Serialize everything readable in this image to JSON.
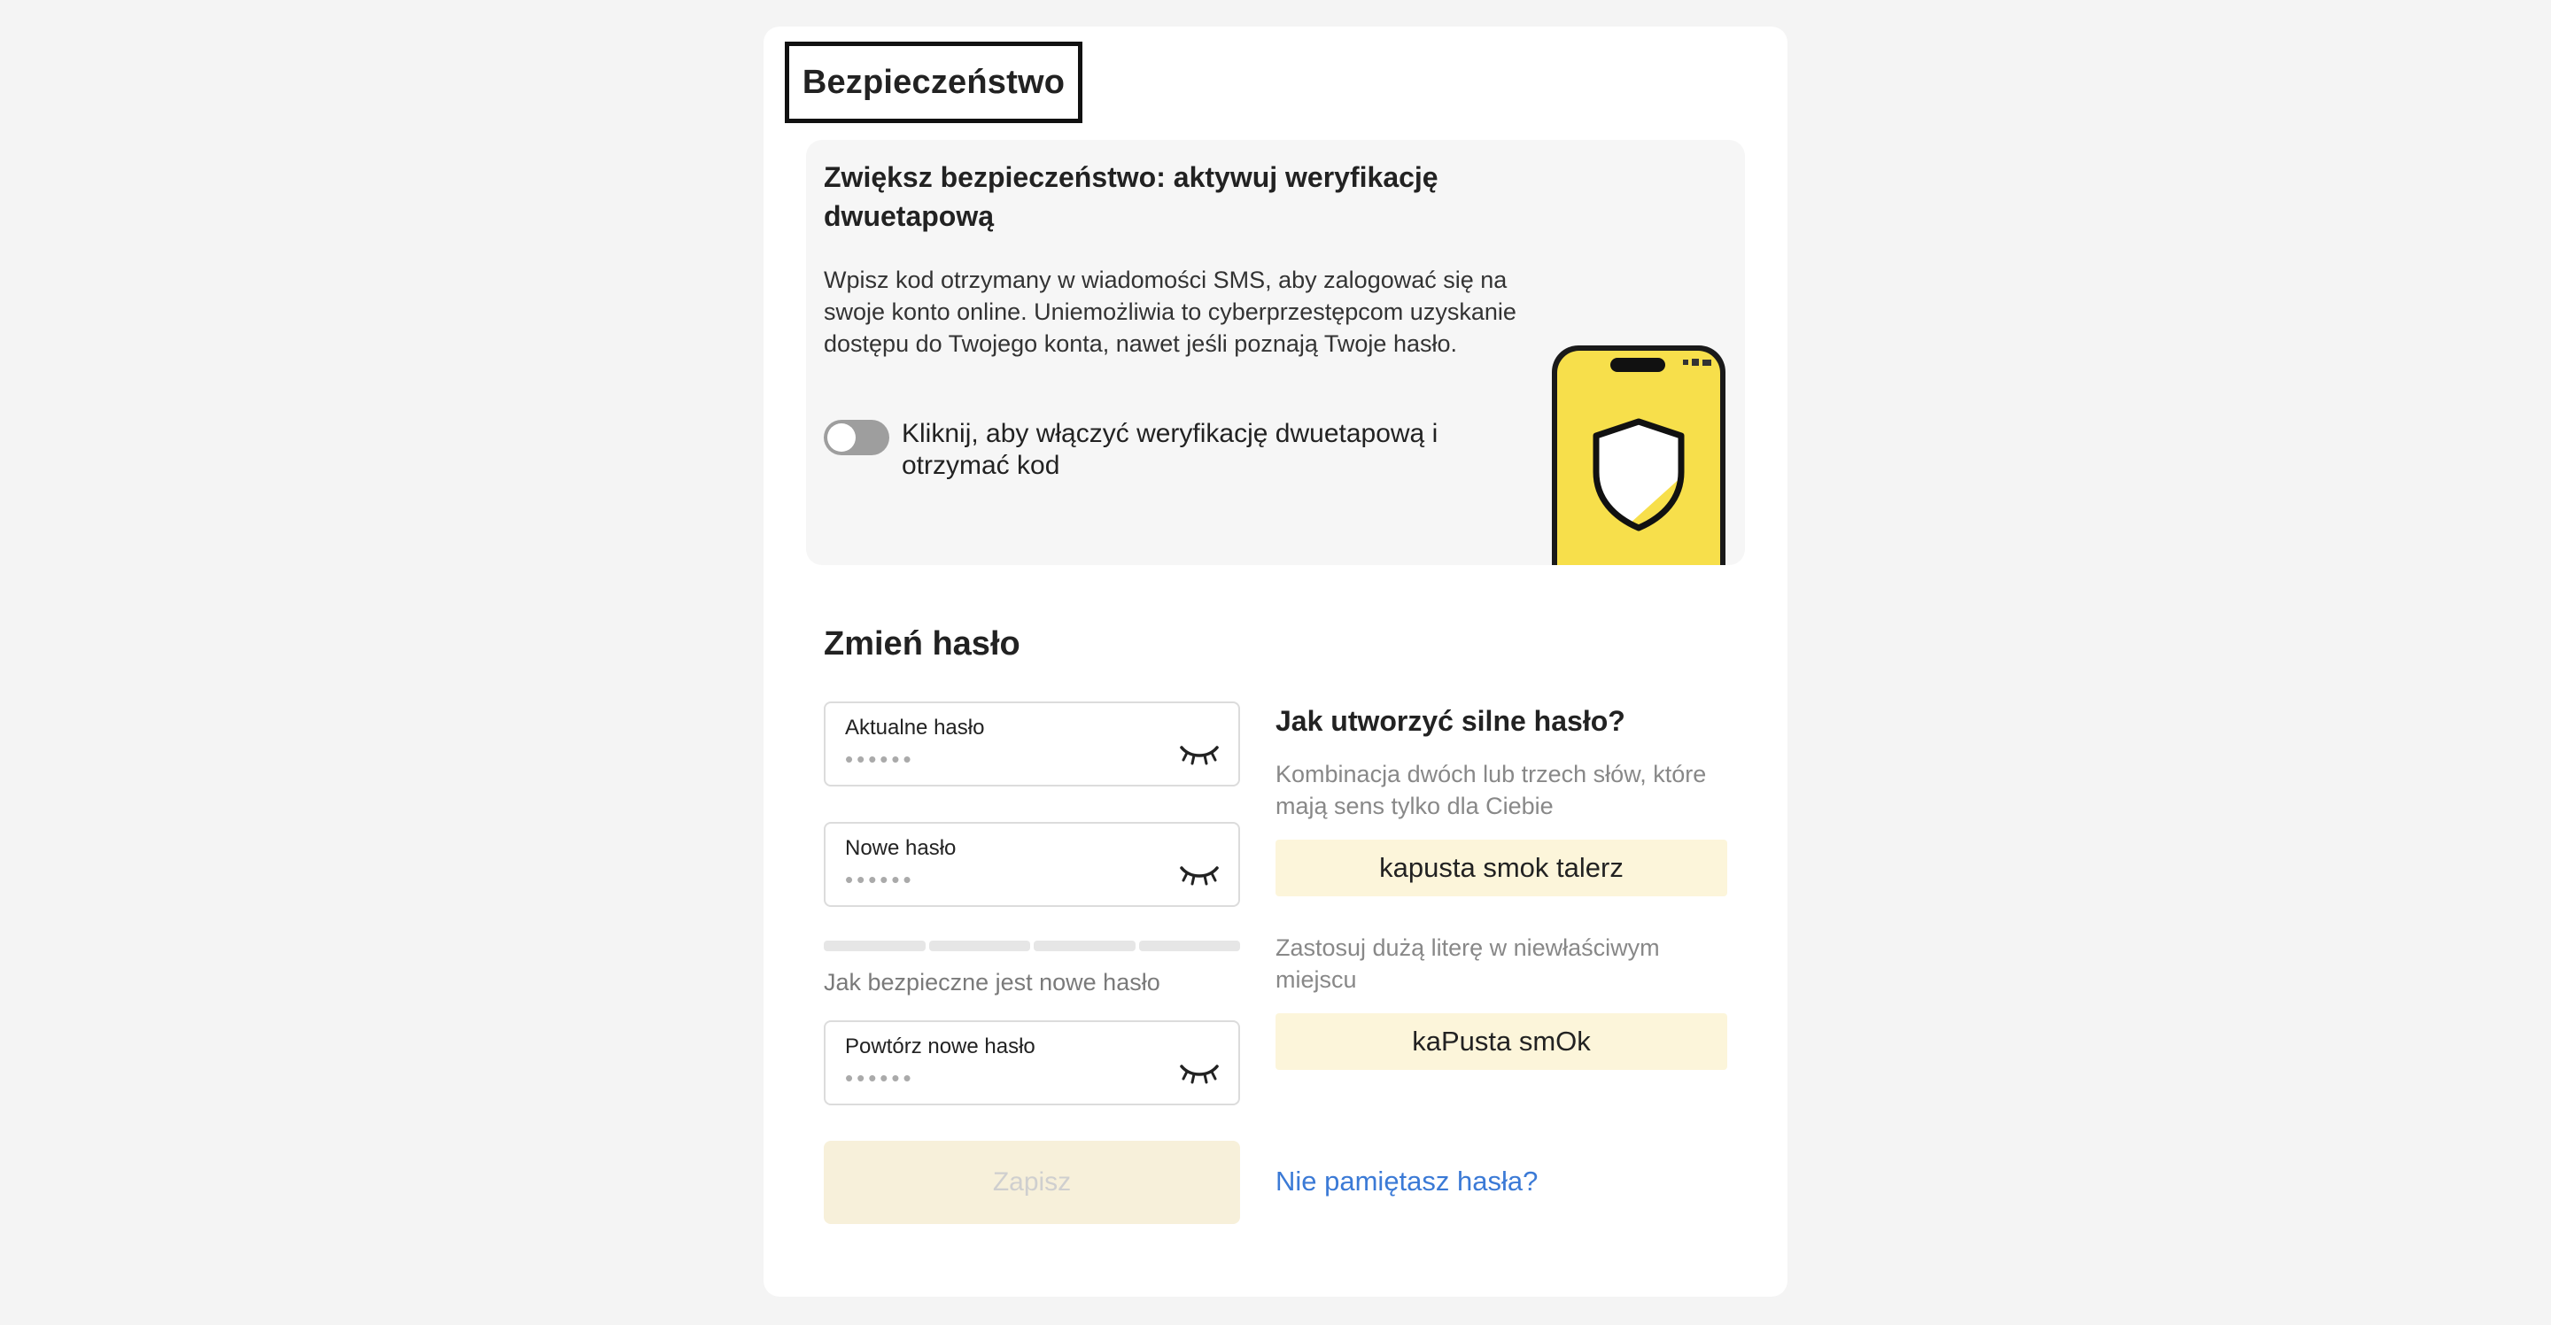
{
  "security": {
    "title": "Bezpieczeństwo"
  },
  "two_factor": {
    "title": "Zwiększ bezpieczeństwo: aktywuj weryfikację dwuetapową",
    "description": "Wpisz kod otrzymany w wiadomości SMS, aby zalogować się na swoje konto online. Uniemożliwia to cyberprzestępcom uzyskanie dostępu do Twojego konta, nawet jeśli poznają Twoje hasło.",
    "toggle_label": "Kliknij, aby włączyć weryfikację dwuetapową i otrzymać kod",
    "toggle_on": false,
    "illustration_icon": "phone-shield-icon"
  },
  "change_password": {
    "title": "Zmień hasło",
    "current": {
      "label": "Aktualne hasło",
      "value": "••••••"
    },
    "new": {
      "label": "Nowe hasło",
      "value": "••••••"
    },
    "repeat": {
      "label": "Powtórz nowe hasło",
      "value": "••••••"
    },
    "strength_label": "Jak bezpieczne jest nowe hasło",
    "strength_level": 0,
    "save_label": "Zapisz",
    "forgot_label": "Nie pamiętasz hasła?"
  },
  "tips": {
    "title": "Jak utworzyć silne hasło?",
    "tip1": "Kombinacja dwóch lub trzech słów, które mają sens tylko dla Ciebie",
    "example1": "kapusta smok talerz",
    "tip2": "Zastosuj dużą literę w niewłaściwym miejscu",
    "example2": "kaPusta smOk"
  },
  "colors": {
    "accent": "#f7df4b",
    "link": "#3b7ad6",
    "toggle_off": "#9e9e9e",
    "example_bg": "#fcf5da"
  }
}
